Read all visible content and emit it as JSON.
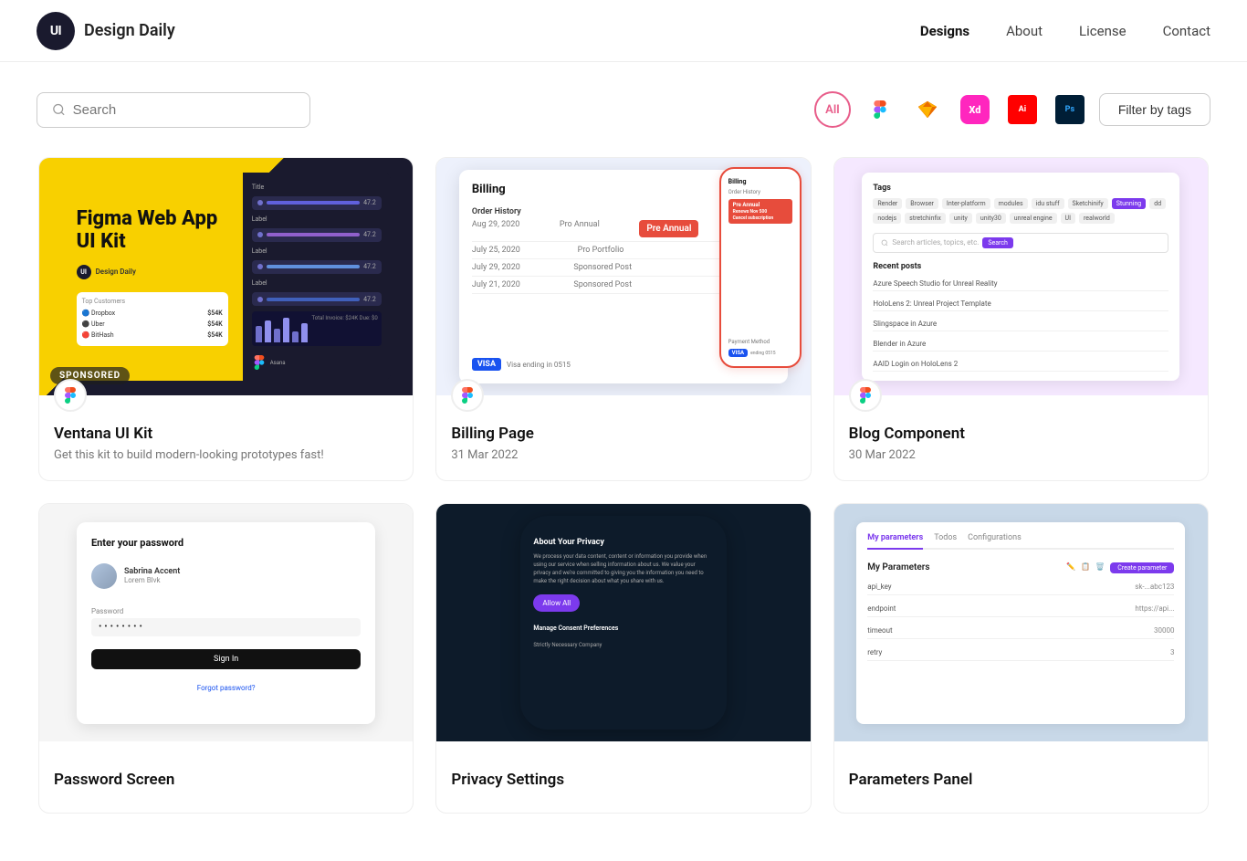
{
  "header": {
    "logo_text": "Design Daily",
    "logo_abbr": "UI",
    "nav": [
      {
        "label": "Designs",
        "active": true
      },
      {
        "label": "About",
        "active": false
      },
      {
        "label": "License",
        "active": false
      },
      {
        "label": "Contact",
        "active": false
      }
    ]
  },
  "filter": {
    "search_placeholder": "Search",
    "all_label": "All",
    "filter_tags_label": "Filter by tags",
    "icons": [
      {
        "name": "all",
        "label": "All"
      },
      {
        "name": "figma",
        "label": "Figma"
      },
      {
        "name": "sketch",
        "label": "Sketch"
      },
      {
        "name": "xd",
        "label": "XD"
      },
      {
        "name": "ai",
        "label": "Illustrator"
      },
      {
        "name": "ps",
        "label": "Photoshop"
      }
    ]
  },
  "cards": [
    {
      "id": "ventana",
      "title": "Ventana UI Kit",
      "subtitle": "Get this kit to build modern-looking prototypes fast!",
      "sponsored": true,
      "sponsored_label": "SPONSORED",
      "tool": "figma",
      "date": ""
    },
    {
      "id": "billing",
      "title": "Billing Page",
      "subtitle": "31 Mar 2022",
      "sponsored": false,
      "tool": "figma",
      "date": "31 Mar 2022"
    },
    {
      "id": "blog",
      "title": "Blog Component",
      "subtitle": "30 Mar 2022",
      "sponsored": false,
      "tool": "figma",
      "date": "30 Mar 2022"
    },
    {
      "id": "password",
      "title": "Password Screen",
      "subtitle": "",
      "sponsored": false,
      "tool": "figma",
      "date": ""
    },
    {
      "id": "privacy",
      "title": "Privacy Settings",
      "subtitle": "",
      "sponsored": false,
      "tool": "figma",
      "date": ""
    },
    {
      "id": "params",
      "title": "Parameters Panel",
      "subtitle": "",
      "sponsored": false,
      "tool": "figma",
      "date": ""
    }
  ]
}
